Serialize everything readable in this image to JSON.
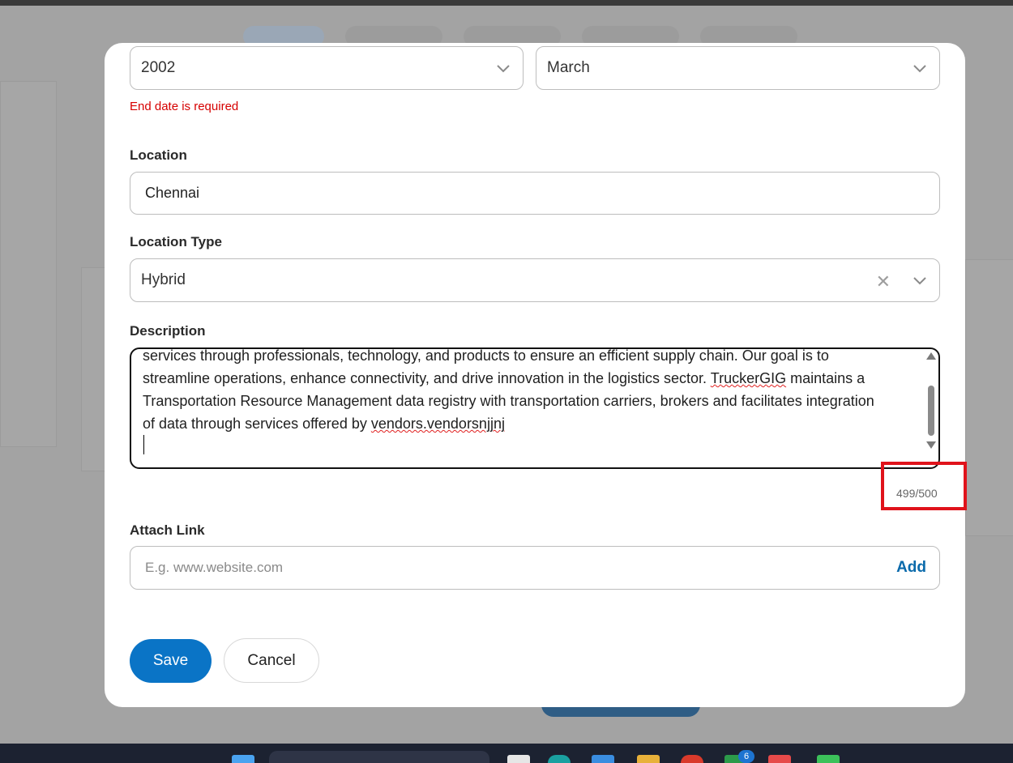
{
  "form": {
    "end_year": "2002",
    "end_month": "March",
    "end_date_error": "End date is required",
    "location_label": "Location",
    "location_value": "Chennai",
    "location_type_label": "Location Type",
    "location_type_value": "Hybrid",
    "description_label": "Description",
    "description_lines": [
      "services through professionals, technology, and products to ensure an efficient supply chain. Our goal is to",
      "streamline operations, enhance connectivity, and drive innovation in the logistics sector.",
      "TruckerGIG",
      "maintains a",
      "Transportation Resource Management data registry with transportation carriers, brokers and facilitates integration",
      "of data through services offered by",
      "vendors.vendorsnjjnj"
    ],
    "char_counter": "499/500",
    "attach_link_label": "Attach Link",
    "attach_link_placeholder": "E.g. www.website.com",
    "add_label": "Add",
    "save_label": "Save",
    "cancel_label": "Cancel"
  },
  "icons": {
    "select_chevron": "chevron-down-icon",
    "clear": "close-icon",
    "scroll_up": "scroll-up-arrow-icon",
    "scroll_down": "scroll-down-arrow-icon"
  },
  "taskbar": {
    "notification_badge": "6"
  },
  "colors": {
    "primary": "#0a74c6",
    "error": "#d60000",
    "link": "#0a6aab",
    "highlight_box": "#e0131b"
  }
}
